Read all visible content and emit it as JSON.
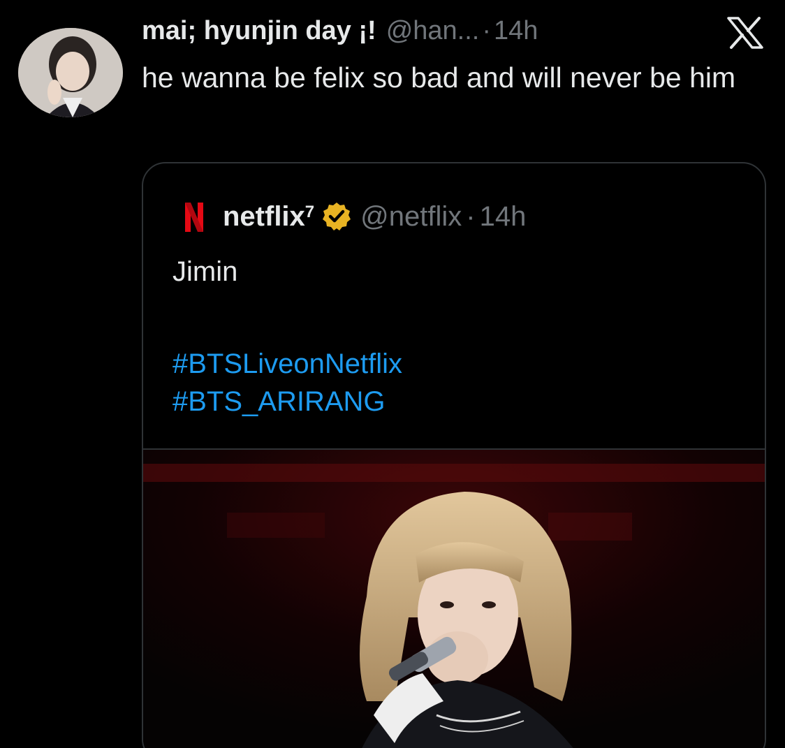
{
  "tweet": {
    "display_name": "mai; hyunjin day ¡!",
    "handle": "@han...",
    "separator": "·",
    "time": "14h",
    "text": "he wanna be felix so bad and will never be him"
  },
  "quoted_tweet": {
    "display_name": "netflix",
    "name_superscript": "7",
    "handle": "@netflix",
    "separator": "·",
    "time": "14h",
    "text": "Jimin",
    "hashtags": [
      "#BTSLiveonNetflix",
      "#BTS_ARIRANG"
    ]
  },
  "icons": {
    "platform_logo": "x-logo-icon",
    "verified": "verified-badge-icon",
    "brand_logo": "netflix-logo-icon"
  },
  "colors": {
    "background": "#000000",
    "primary_text": "#e7e9ea",
    "secondary_text": "#71767b",
    "hashtag": "#1d9bf0",
    "border": "#2f3336",
    "verified_gold": "#e8b323",
    "netflix_red": "#e50914"
  }
}
